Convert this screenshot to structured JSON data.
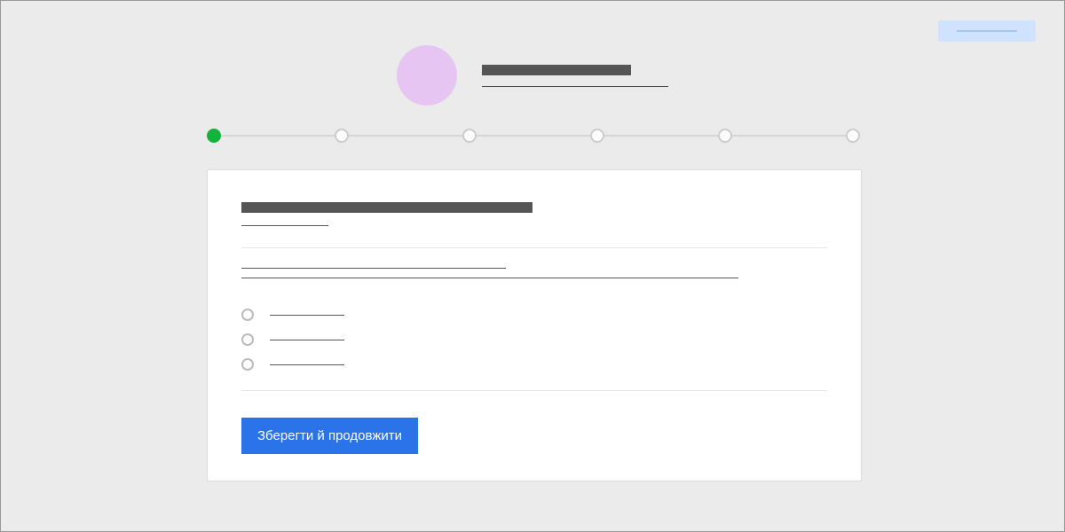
{
  "top_action": {
    "placeholder_style": "highlight"
  },
  "header": {
    "title": "",
    "subtitle": ""
  },
  "stepper": {
    "total_steps": 6,
    "current": 1
  },
  "card": {
    "heading": "",
    "subheading": "",
    "field_label": "",
    "field_value": "",
    "options": [
      {
        "label": ""
      },
      {
        "label": ""
      },
      {
        "label": ""
      }
    ]
  },
  "buttons": {
    "save_continue": "Зберегти й продовжити"
  }
}
